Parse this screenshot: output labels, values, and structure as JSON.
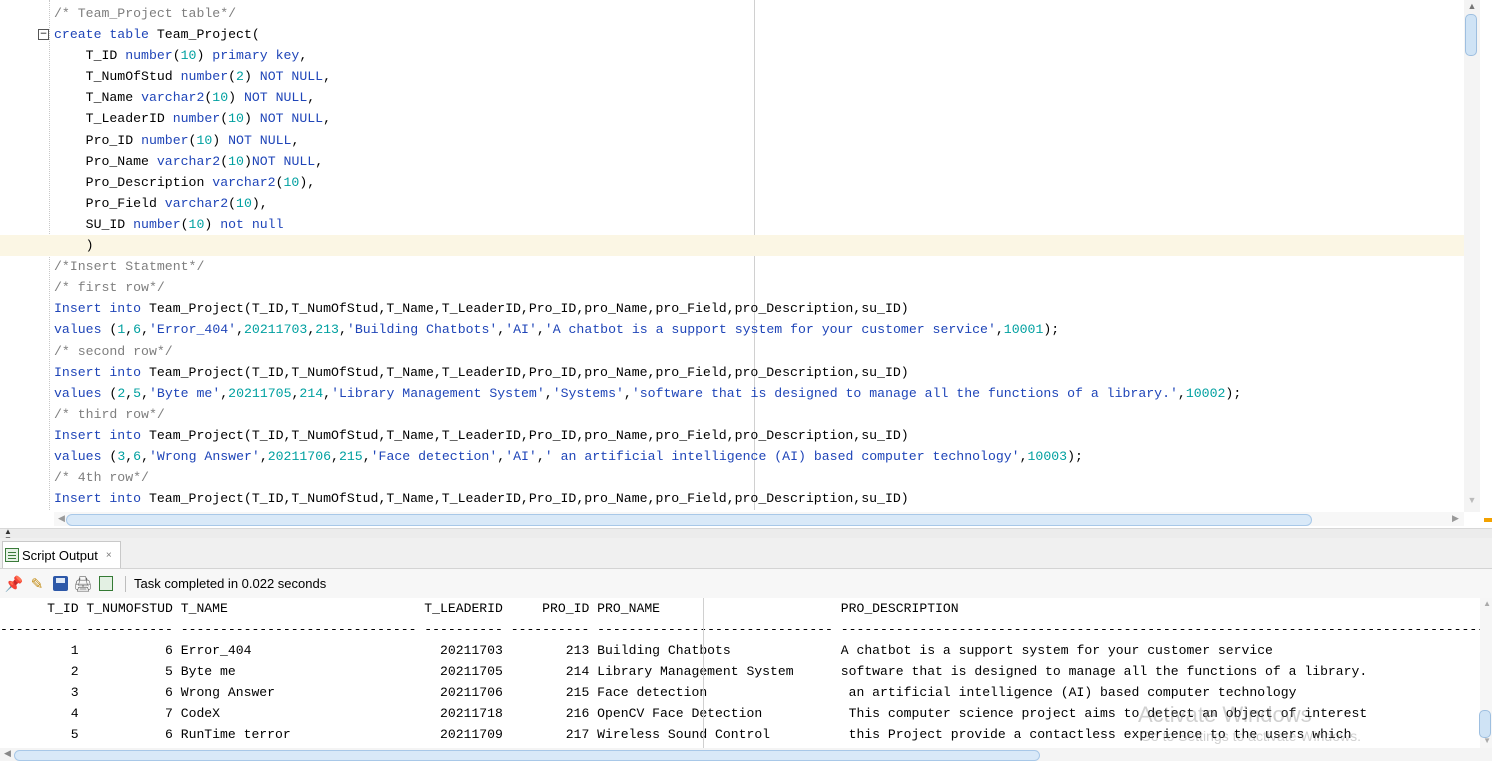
{
  "editor": {
    "lines": [
      {
        "segs": [
          {
            "t": "/* Team_Project table*/",
            "c": "com"
          }
        ]
      },
      {
        "fold": "true",
        "segs": [
          {
            "t": "create table ",
            "c": "kw"
          },
          {
            "t": "Team_Project(",
            "c": "plain"
          }
        ]
      },
      {
        "segs": [
          {
            "t": "    T_ID ",
            "c": "plain"
          },
          {
            "t": "number",
            "c": "kw"
          },
          {
            "t": "(",
            "c": "plain"
          },
          {
            "t": "10",
            "c": "num"
          },
          {
            "t": ") ",
            "c": "plain"
          },
          {
            "t": "primary key",
            "c": "kw"
          },
          {
            "t": ",",
            "c": "plain"
          }
        ]
      },
      {
        "segs": [
          {
            "t": "    T_NumOfStud ",
            "c": "plain"
          },
          {
            "t": "number",
            "c": "kw"
          },
          {
            "t": "(",
            "c": "plain"
          },
          {
            "t": "2",
            "c": "num"
          },
          {
            "t": ") ",
            "c": "plain"
          },
          {
            "t": "NOT NULL",
            "c": "kw"
          },
          {
            "t": ",",
            "c": "plain"
          }
        ]
      },
      {
        "segs": [
          {
            "t": "    T_Name ",
            "c": "plain"
          },
          {
            "t": "varchar2",
            "c": "kw"
          },
          {
            "t": "(",
            "c": "plain"
          },
          {
            "t": "10",
            "c": "num"
          },
          {
            "t": ") ",
            "c": "plain"
          },
          {
            "t": "NOT NULL",
            "c": "kw"
          },
          {
            "t": ",",
            "c": "plain"
          }
        ]
      },
      {
        "segs": [
          {
            "t": "    T_LeaderID ",
            "c": "plain"
          },
          {
            "t": "number",
            "c": "kw"
          },
          {
            "t": "(",
            "c": "plain"
          },
          {
            "t": "10",
            "c": "num"
          },
          {
            "t": ") ",
            "c": "plain"
          },
          {
            "t": "NOT NULL",
            "c": "kw"
          },
          {
            "t": ",",
            "c": "plain"
          }
        ]
      },
      {
        "segs": [
          {
            "t": "    Pro_ID ",
            "c": "plain"
          },
          {
            "t": "number",
            "c": "kw"
          },
          {
            "t": "(",
            "c": "plain"
          },
          {
            "t": "10",
            "c": "num"
          },
          {
            "t": ") ",
            "c": "plain"
          },
          {
            "t": "NOT NULL",
            "c": "kw"
          },
          {
            "t": ",",
            "c": "plain"
          }
        ]
      },
      {
        "segs": [
          {
            "t": "    Pro_Name ",
            "c": "plain"
          },
          {
            "t": "varchar2",
            "c": "kw"
          },
          {
            "t": "(",
            "c": "plain"
          },
          {
            "t": "10",
            "c": "num"
          },
          {
            "t": ")",
            "c": "plain"
          },
          {
            "t": "NOT NULL",
            "c": "kw"
          },
          {
            "t": ",",
            "c": "plain"
          }
        ]
      },
      {
        "segs": [
          {
            "t": "    Pro_Description ",
            "c": "plain"
          },
          {
            "t": "varchar2",
            "c": "kw"
          },
          {
            "t": "(",
            "c": "plain"
          },
          {
            "t": "10",
            "c": "num"
          },
          {
            "t": "),",
            "c": "plain"
          }
        ]
      },
      {
        "segs": [
          {
            "t": "    Pro_Field ",
            "c": "plain"
          },
          {
            "t": "varchar2",
            "c": "kw"
          },
          {
            "t": "(",
            "c": "plain"
          },
          {
            "t": "10",
            "c": "num"
          },
          {
            "t": "),",
            "c": "plain"
          }
        ]
      },
      {
        "segs": [
          {
            "t": "    SU_ID ",
            "c": "plain"
          },
          {
            "t": "number",
            "c": "kw"
          },
          {
            "t": "(",
            "c": "plain"
          },
          {
            "t": "10",
            "c": "num"
          },
          {
            "t": ") ",
            "c": "plain"
          },
          {
            "t": "not null",
            "c": "kw"
          }
        ]
      },
      {
        "hl": "true",
        "segs": [
          {
            "t": "    )",
            "c": "plain"
          }
        ]
      },
      {
        "segs": [
          {
            "t": "/*Insert Statment*/",
            "c": "com"
          }
        ]
      },
      {
        "segs": [
          {
            "t": "/* first row*/",
            "c": "com"
          }
        ]
      },
      {
        "segs": [
          {
            "t": "Insert into ",
            "c": "kw"
          },
          {
            "t": "Team_Project(T_ID,T_NumOfStud,T_Name,T_LeaderID,Pro_ID,pro_Name,pro_Field,pro_Description,su_ID)",
            "c": "plain"
          }
        ]
      },
      {
        "segs": [
          {
            "t": "values ",
            "c": "kw"
          },
          {
            "t": "(",
            "c": "plain"
          },
          {
            "t": "1",
            "c": "num"
          },
          {
            "t": ",",
            "c": "plain"
          },
          {
            "t": "6",
            "c": "num"
          },
          {
            "t": ",",
            "c": "plain"
          },
          {
            "t": "'Error_404'",
            "c": "str"
          },
          {
            "t": ",",
            "c": "plain"
          },
          {
            "t": "20211703",
            "c": "num"
          },
          {
            "t": ",",
            "c": "plain"
          },
          {
            "t": "213",
            "c": "num"
          },
          {
            "t": ",",
            "c": "plain"
          },
          {
            "t": "'Building Chatbots'",
            "c": "str"
          },
          {
            "t": ",",
            "c": "plain"
          },
          {
            "t": "'AI'",
            "c": "str"
          },
          {
            "t": ",",
            "c": "plain"
          },
          {
            "t": "'A chatbot is a support system for your customer service'",
            "c": "str"
          },
          {
            "t": ",",
            "c": "plain"
          },
          {
            "t": "10001",
            "c": "num"
          },
          {
            "t": ");",
            "c": "plain"
          }
        ]
      },
      {
        "segs": [
          {
            "t": "/* second row*/",
            "c": "com"
          }
        ]
      },
      {
        "segs": [
          {
            "t": "Insert into ",
            "c": "kw"
          },
          {
            "t": "Team_Project(T_ID,T_NumOfStud,T_Name,T_LeaderID,Pro_ID,pro_Name,pro_Field,pro_Description,su_ID)",
            "c": "plain"
          }
        ]
      },
      {
        "segs": [
          {
            "t": "values ",
            "c": "kw"
          },
          {
            "t": "(",
            "c": "plain"
          },
          {
            "t": "2",
            "c": "num"
          },
          {
            "t": ",",
            "c": "plain"
          },
          {
            "t": "5",
            "c": "num"
          },
          {
            "t": ",",
            "c": "plain"
          },
          {
            "t": "'Byte me'",
            "c": "str"
          },
          {
            "t": ",",
            "c": "plain"
          },
          {
            "t": "20211705",
            "c": "num"
          },
          {
            "t": ",",
            "c": "plain"
          },
          {
            "t": "214",
            "c": "num"
          },
          {
            "t": ",",
            "c": "plain"
          },
          {
            "t": "'Library Management System'",
            "c": "str"
          },
          {
            "t": ",",
            "c": "plain"
          },
          {
            "t": "'Systems'",
            "c": "str"
          },
          {
            "t": ",",
            "c": "plain"
          },
          {
            "t": "'software that is designed to manage all the functions of a library.'",
            "c": "str"
          },
          {
            "t": ",",
            "c": "plain"
          },
          {
            "t": "10002",
            "c": "num"
          },
          {
            "t": ");",
            "c": "plain"
          }
        ]
      },
      {
        "segs": [
          {
            "t": "/* third row*/",
            "c": "com"
          }
        ]
      },
      {
        "segs": [
          {
            "t": "Insert into ",
            "c": "kw"
          },
          {
            "t": "Team_Project(T_ID,T_NumOfStud,T_Name,T_LeaderID,Pro_ID,pro_Name,pro_Field,pro_Description,su_ID)",
            "c": "plain"
          }
        ]
      },
      {
        "segs": [
          {
            "t": "values ",
            "c": "kw"
          },
          {
            "t": "(",
            "c": "plain"
          },
          {
            "t": "3",
            "c": "num"
          },
          {
            "t": ",",
            "c": "plain"
          },
          {
            "t": "6",
            "c": "num"
          },
          {
            "t": ",",
            "c": "plain"
          },
          {
            "t": "'Wrong Answer'",
            "c": "str"
          },
          {
            "t": ",",
            "c": "plain"
          },
          {
            "t": "20211706",
            "c": "num"
          },
          {
            "t": ",",
            "c": "plain"
          },
          {
            "t": "215",
            "c": "num"
          },
          {
            "t": ",",
            "c": "plain"
          },
          {
            "t": "'Face detection'",
            "c": "str"
          },
          {
            "t": ",",
            "c": "plain"
          },
          {
            "t": "'AI'",
            "c": "str"
          },
          {
            "t": ",",
            "c": "plain"
          },
          {
            "t": "' an artificial intelligence (AI) based computer technology'",
            "c": "str"
          },
          {
            "t": ",",
            "c": "plain"
          },
          {
            "t": "10003",
            "c": "num"
          },
          {
            "t": ");",
            "c": "plain"
          }
        ]
      },
      {
        "segs": [
          {
            "t": "/* 4th row*/",
            "c": "com"
          }
        ]
      },
      {
        "segs": [
          {
            "t": "Insert into ",
            "c": "kw"
          },
          {
            "t": "Team_Project(T_ID,T_NumOfStud,T_Name,T_LeaderID,Pro_ID,pro_Name,pro_Field,pro_Description,su_ID)",
            "c": "plain"
          }
        ]
      }
    ]
  },
  "fold_icon": "−",
  "panel": {
    "tab_label": "Script Output",
    "tab_close": "×",
    "status": "Task completed in 0.022 seconds"
  },
  "toolbar_icons": {
    "pin": "📌",
    "eraser": "✎",
    "print": "🖨"
  },
  "output": {
    "lines": [
      "      T_ID T_NUMOFSTUD T_NAME                         T_LEADERID     PRO_ID PRO_NAME                       PRO_DESCRIPTION",
      "---------- ----------- ------------------------------ ---------- ---------- ------------------------------ ----------------------------------------------------------------------------------------------------",
      "         1           6 Error_404                        20211703        213 Building Chatbots              A chatbot is a support system for your customer service",
      "         2           5 Byte me                          20211705        214 Library Management System      software that is designed to manage all the functions of a library.",
      "         3           6 Wrong Answer                     20211706        215 Face detection                  an artificial intelligence (AI) based computer technology",
      "         4           7 CodeX                            20211718        216 OpenCV Face Detection           This computer science project aims to detect an object of interest",
      "         5           6 RunTime terror                   20211709        217 Wireless Sound Control          this Project provide a contactless experience to the users which"
    ]
  },
  "watermark": {
    "title": "Activate Windows",
    "subtitle": "Go to Settings to activate Windows."
  }
}
